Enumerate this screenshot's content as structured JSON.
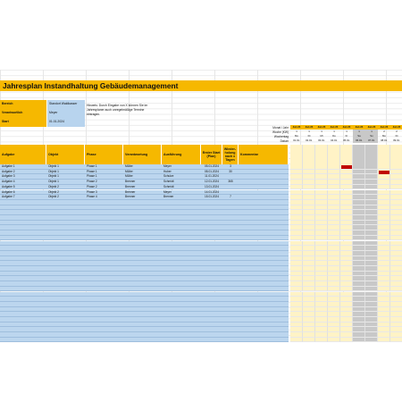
{
  "title": "Jahresplan Instandhaltung Gebäudemanagement",
  "meta": [
    {
      "label": "Bereich",
      "value": "Standort Waldkasser"
    },
    {
      "label": "Verantwortlich",
      "value": "Meyer"
    },
    {
      "label": "Start",
      "value": "01.01.2024"
    }
  ],
  "hint": "Hinweis: Durch Eingabe von X können Sie im Jahresplaner auch unregelmäßige Termine eintragen.",
  "gantt_labels": {
    "month": "Monat / Jahr",
    "week": "Woche (KW)",
    "weekday": "Wochentag",
    "date": "Datum"
  },
  "days": [
    {
      "month": "Jan 24",
      "week": "1",
      "weekday": "Mo",
      "date": "01.01.",
      "weekend": false
    },
    {
      "month": "Jan 24",
      "week": "1",
      "weekday": "Di",
      "date": "02.01.",
      "weekend": false
    },
    {
      "month": "Jan 24",
      "week": "1",
      "weekday": "Mi",
      "date": "03.01.",
      "weekend": false
    },
    {
      "month": "Jan 24",
      "week": "1",
      "weekday": "Do",
      "date": "04.01.",
      "weekend": false
    },
    {
      "month": "Jan 24",
      "week": "1",
      "weekday": "Fr",
      "date": "05.01.",
      "weekend": false
    },
    {
      "month": "Jan 24",
      "week": "1",
      "weekday": "Sa",
      "date": "06.01.",
      "weekend": true
    },
    {
      "month": "Jan 24",
      "week": "1",
      "weekday": "So",
      "date": "07.01.",
      "weekend": true
    },
    {
      "month": "Jan 24",
      "week": "2",
      "weekday": "Mo",
      "date": "08.01.",
      "weekend": false
    },
    {
      "month": "Jan 24",
      "week": "2",
      "weekday": "Di",
      "date": "09.01.",
      "weekend": false
    }
  ],
  "headers": {
    "aufgabe": "Aufgabe",
    "objekt": "Objekt",
    "phase": "Phase",
    "verantwortung": "Verantwortung",
    "ausfuehrung": "Ausführung",
    "erster_start": "Erster Start (Plan)",
    "wiederholung": "Wieder-holung nach x Tagen",
    "kommentar": "Kommentar"
  },
  "tasks": [
    {
      "aufgabe": "Aufgabe 1",
      "objekt": "Objekt 1",
      "phase": "Phase 1",
      "verantwortung": "Müller",
      "ausfuehrung": "Meyer",
      "start": "05.01.2024",
      "wdh": "3",
      "bars": [
        4
      ]
    },
    {
      "aufgabe": "Aufgabe 2",
      "objekt": "Objekt 1",
      "phase": "Phase 1",
      "verantwortung": "Müller",
      "ausfuehrung": "Huber",
      "start": "08.01.2024",
      "wdh": "30",
      "bars": [
        7
      ]
    },
    {
      "aufgabe": "Aufgabe 3",
      "objekt": "Objekt 1",
      "phase": "Phase 1",
      "verantwortung": "Müller",
      "ausfuehrung": "Schulze",
      "start": "11.01.2024",
      "wdh": "",
      "bars": []
    },
    {
      "aufgabe": "Aufgabe 4",
      "objekt": "Objekt 1",
      "phase": "Phase 2",
      "verantwortung": "Brenner",
      "ausfuehrung": "Schmidt",
      "start": "12.01.2024",
      "wdh": "365",
      "bars": []
    },
    {
      "aufgabe": "Aufgabe 5",
      "objekt": "Objekt 2",
      "phase": "Phase 2",
      "verantwortung": "Brenner",
      "ausfuehrung": "Schmidt",
      "start": "13.01.2024",
      "wdh": "",
      "bars": []
    },
    {
      "aufgabe": "Aufgabe 6",
      "objekt": "Objekt 2",
      "phase": "Phase 3",
      "verantwortung": "Brenner",
      "ausfuehrung": "Meyer",
      "start": "14.01.2024",
      "wdh": "",
      "bars": []
    },
    {
      "aufgabe": "Aufgabe 7",
      "objekt": "Objekt 2",
      "phase": "Phase 4",
      "verantwortung": "Brenner",
      "ausfuehrung": "Brenner",
      "start": "15.01.2024",
      "wdh": "7",
      "bars": []
    }
  ],
  "empty_rows": 28,
  "colors": {
    "accent": "#f6b800",
    "table_blue": "#bcd6ee",
    "bar_red": "#c00000",
    "weekend_gray": "#c8c8c8"
  }
}
